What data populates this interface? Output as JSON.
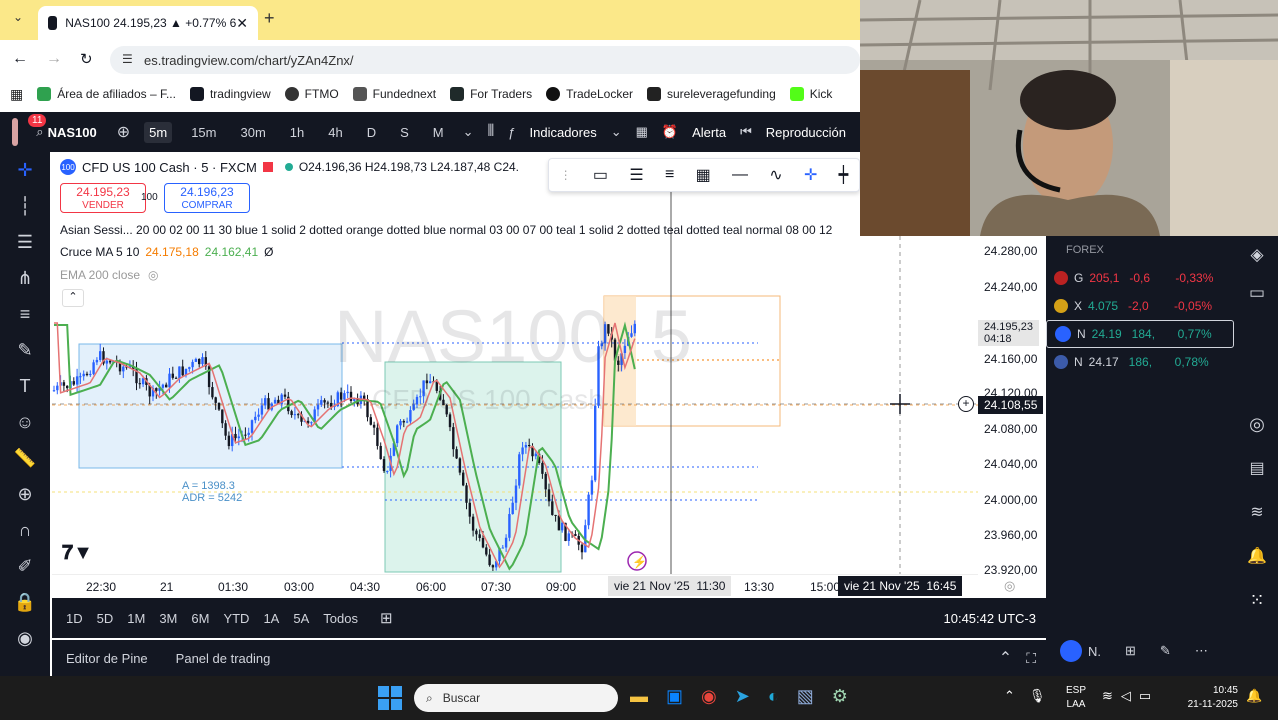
{
  "browser": {
    "tab_title": "NAS100 24.195,23 ▲ +0.77% 6",
    "url": "es.tradingview.com/chart/yZAn4Znx/",
    "bookmarks": [
      "Área de afiliados – F...",
      "tradingview",
      "FTMO",
      "Fundednext",
      "For Traders",
      "TradeLocker",
      "sureleveragefunding",
      "Kick"
    ]
  },
  "tv_toolbar": {
    "notif_count": "11",
    "symbol": "NAS100",
    "timeframes": [
      "5m",
      "15m",
      "30m",
      "1h",
      "4h",
      "D",
      "S",
      "M"
    ],
    "active_timeframe": "5m",
    "indicators_label": "Indicadores",
    "alert_label": "Alerta",
    "replay_label": "Reproducción"
  },
  "legend": {
    "title": "CFD US 100 Cash · 5 · FXCM",
    "ohlc": "O24.196,36 H24.198,73 L24.187,48 C24.",
    "sell_price": "24.195,23",
    "sell_label": "VENDER",
    "spread": "100",
    "buy_price": "24.196,23",
    "buy_label": "COMPRAR",
    "sessions": "Asian Sessi... 20 00 02 00 11 30 blue 1 solid 2 dotted orange dotted blue normal 03 00 07 00 teal 1 solid 2 dotted teal dotted teal normal 08 00 12",
    "ma_name": "Cruce MA 5 10",
    "ma_val1": "24.175,18",
    "ma_val2": "24.162,41",
    "ma_val3": "Ø",
    "ema_label": "EMA 200 close"
  },
  "watermark": {
    "symbol": "NAS100, 5",
    "name": "CFD US 100 Cash"
  },
  "annotation": {
    "a": "A = 1398.3",
    "adr": "ADR = 5242"
  },
  "price_axis": [
    "24.280,00",
    "24.240,00",
    "24.195,23",
    "24.160,00",
    "24.120,00",
    "24.108,55",
    "24.080,00",
    "24.040,00",
    "24.000,00",
    "23.960,00",
    "23.920,00"
  ],
  "price_countdown": "04:18",
  "time_axis": [
    "22:30",
    "21",
    "01:30",
    "03:00",
    "04:30",
    "06:00",
    "07:30",
    "09:00",
    "11:30",
    "13:30",
    "15:00"
  ],
  "cursor_date": "vie 21 Nov '25",
  "cursor_time": "11:30",
  "crosshair_date": "vie 21 Nov '25",
  "crosshair_time": "16:45",
  "crosshair_price": "24.108,55",
  "ranges": [
    "1D",
    "5D",
    "1M",
    "3M",
    "6M",
    "YTD",
    "1A",
    "5A",
    "Todos"
  ],
  "clock": "10:45:42 UTC-3",
  "panels": [
    "Editor de Pine",
    "Panel de trading"
  ],
  "watchlist": {
    "section": "FOREX",
    "rows": [
      {
        "sym": "G",
        "last": "205,1",
        "chg": "-0,6",
        "pct": "-0,33%",
        "color": "#f23645"
      },
      {
        "sym": "X",
        "last": "4.075",
        "chg": "-2,0",
        "pct": "-0,05%",
        "color": "#f23645"
      },
      {
        "sym": "N",
        "last": "24.19",
        "chg": "184,",
        "pct": "0,77%",
        "color": "#22ab94"
      },
      {
        "sym": "N",
        "last": "24.17",
        "chg": "186,",
        "pct": "0,78%",
        "color": "#22ab94"
      }
    ],
    "footer_sym": "N."
  },
  "taskbar": {
    "search": "Buscar",
    "lang1": "ESP",
    "lang2": "LAA",
    "time": "10:45",
    "date": "21-11-2025"
  },
  "colors": {
    "bg_dark": "#131722",
    "up": "#22ab94",
    "down": "#f23645",
    "accent": "#2962ff",
    "tabbar": "#fbe889"
  }
}
